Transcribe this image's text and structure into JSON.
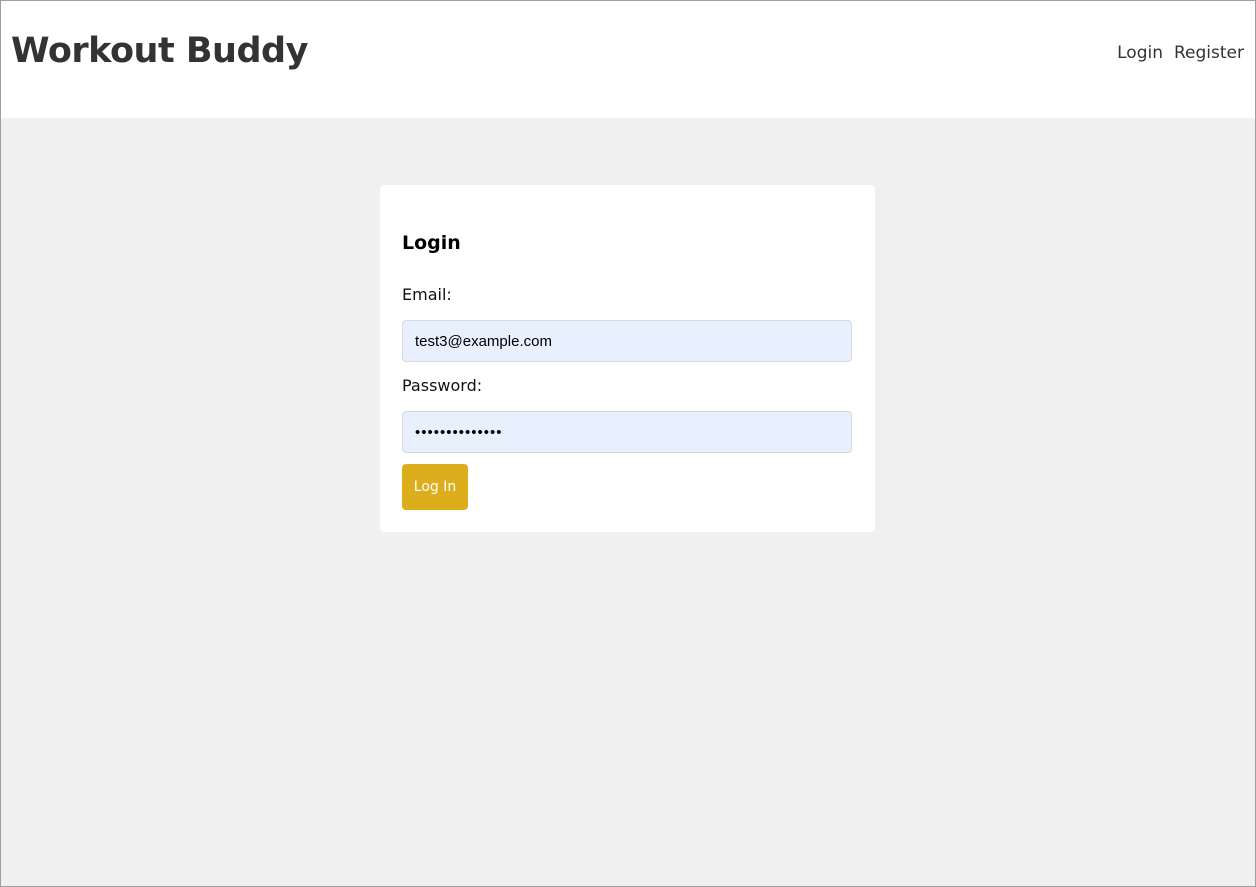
{
  "header": {
    "title": "Workout Buddy",
    "nav": {
      "login": "Login",
      "register": "Register"
    }
  },
  "login_form": {
    "heading": "Login",
    "email_label": "Email:",
    "email_value": "test3@example.com",
    "password_label": "Password:",
    "password_value": "••••••••••••••",
    "submit_label": "Log In"
  },
  "colors": {
    "background": "#f0f0f0",
    "header_bg": "#ffffff",
    "button_bg": "#ddae1c",
    "input_autofill_bg": "#e8f0fe",
    "text": "#333333"
  }
}
